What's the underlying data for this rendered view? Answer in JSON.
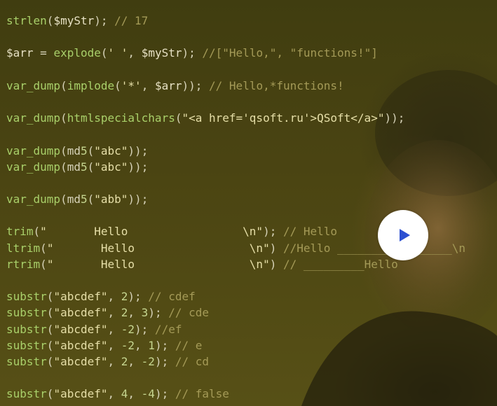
{
  "code_lines": [
    "strlen($myStr); // 17",
    "",
    "$arr = explode(' ', $myStr); //[\"Hello,\", \"functions!\"]",
    "",
    "var_dump(implode('*', $arr)); // Hello,*functions!",
    "",
    "var_dump(htmlspecialchars(\"<a href='qsoft.ru'>QSoft</a>\"));",
    "",
    "var_dump(md5(\"abc\"));",
    "var_dump(md5(\"abc\"));",
    "",
    "var_dump(md5(\"abb\"));",
    "",
    "trim(\"       Hello                 \\n\"); // Hello",
    "ltrim(\"       Hello                 \\n\") //Hello _________________\\n",
    "rtrim(\"       Hello                 \\n\") // _________Hello",
    "",
    "substr(\"abcdef\", 2); // cdef",
    "substr(\"abcdef\", 2, 3); // cde",
    "substr(\"abcdef\", -2); //ef",
    "substr(\"abcdef\", -2, 1); // e",
    "substr(\"abcdef\", 2, -2); // cd",
    "",
    "substr(\"abcdef\", 4, -4); // false"
  ],
  "colors": {
    "background": "#4a4412",
    "function": "#a9d06a",
    "string": "#e6dfa8",
    "comment": "#a49a57",
    "play_button": "#ffffff",
    "play_icon": "#2c4fd1"
  },
  "play_button": {
    "icon": "play-icon"
  }
}
